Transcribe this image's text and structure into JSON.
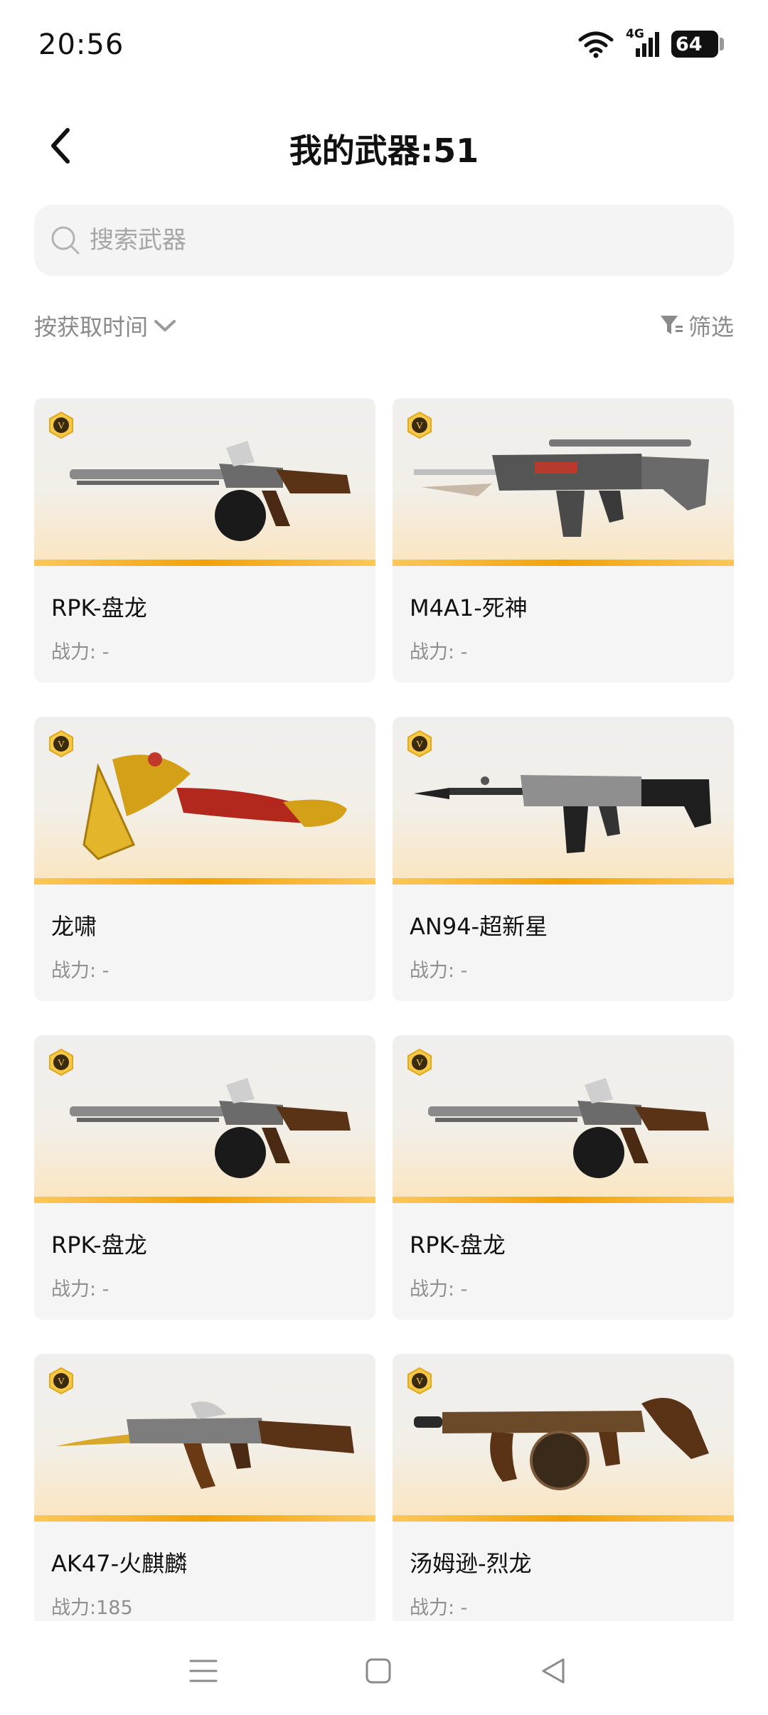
{
  "status_bar": {
    "time": "20:56",
    "network": "4G",
    "battery": "64",
    "icons": [
      "wifi-icon",
      "signal-icon",
      "battery-icon"
    ]
  },
  "header": {
    "title": "我的武器:51",
    "back_icon": "chevron-left-icon"
  },
  "search": {
    "placeholder": "搜索武器",
    "value": "",
    "icon": "search-icon"
  },
  "filters": {
    "sort_label": "按获取时间",
    "sort_icon": "chevron-down-icon",
    "filter_label": "筛选",
    "filter_icon": "funnel-icon"
  },
  "weapons": [
    {
      "name": "RPK-盘龙",
      "power": "战力: -",
      "badge": "V"
    },
    {
      "name": "M4A1-死神",
      "power": "战力: -",
      "badge": "V"
    },
    {
      "name": "龙啸",
      "power": "战力: -",
      "badge": "V"
    },
    {
      "name": "AN94-超新星",
      "power": "战力: -",
      "badge": "V"
    },
    {
      "name": "RPK-盘龙",
      "power": "战力: -",
      "badge": "V"
    },
    {
      "name": "RPK-盘龙",
      "power": "战力: -",
      "badge": "V"
    },
    {
      "name": "AK47-火麒麟",
      "power": "战力:185",
      "badge": "V"
    },
    {
      "name": "汤姆逊-烈龙",
      "power": "战力: -",
      "badge": "V"
    }
  ],
  "colors": {
    "accent_gold": "#f2a20a",
    "card_bg": "#f5f5f5",
    "muted_text": "#8f8f8f"
  },
  "nav_bar": {
    "icons": [
      "menu-icon",
      "home-square-icon",
      "back-triangle-icon"
    ]
  }
}
